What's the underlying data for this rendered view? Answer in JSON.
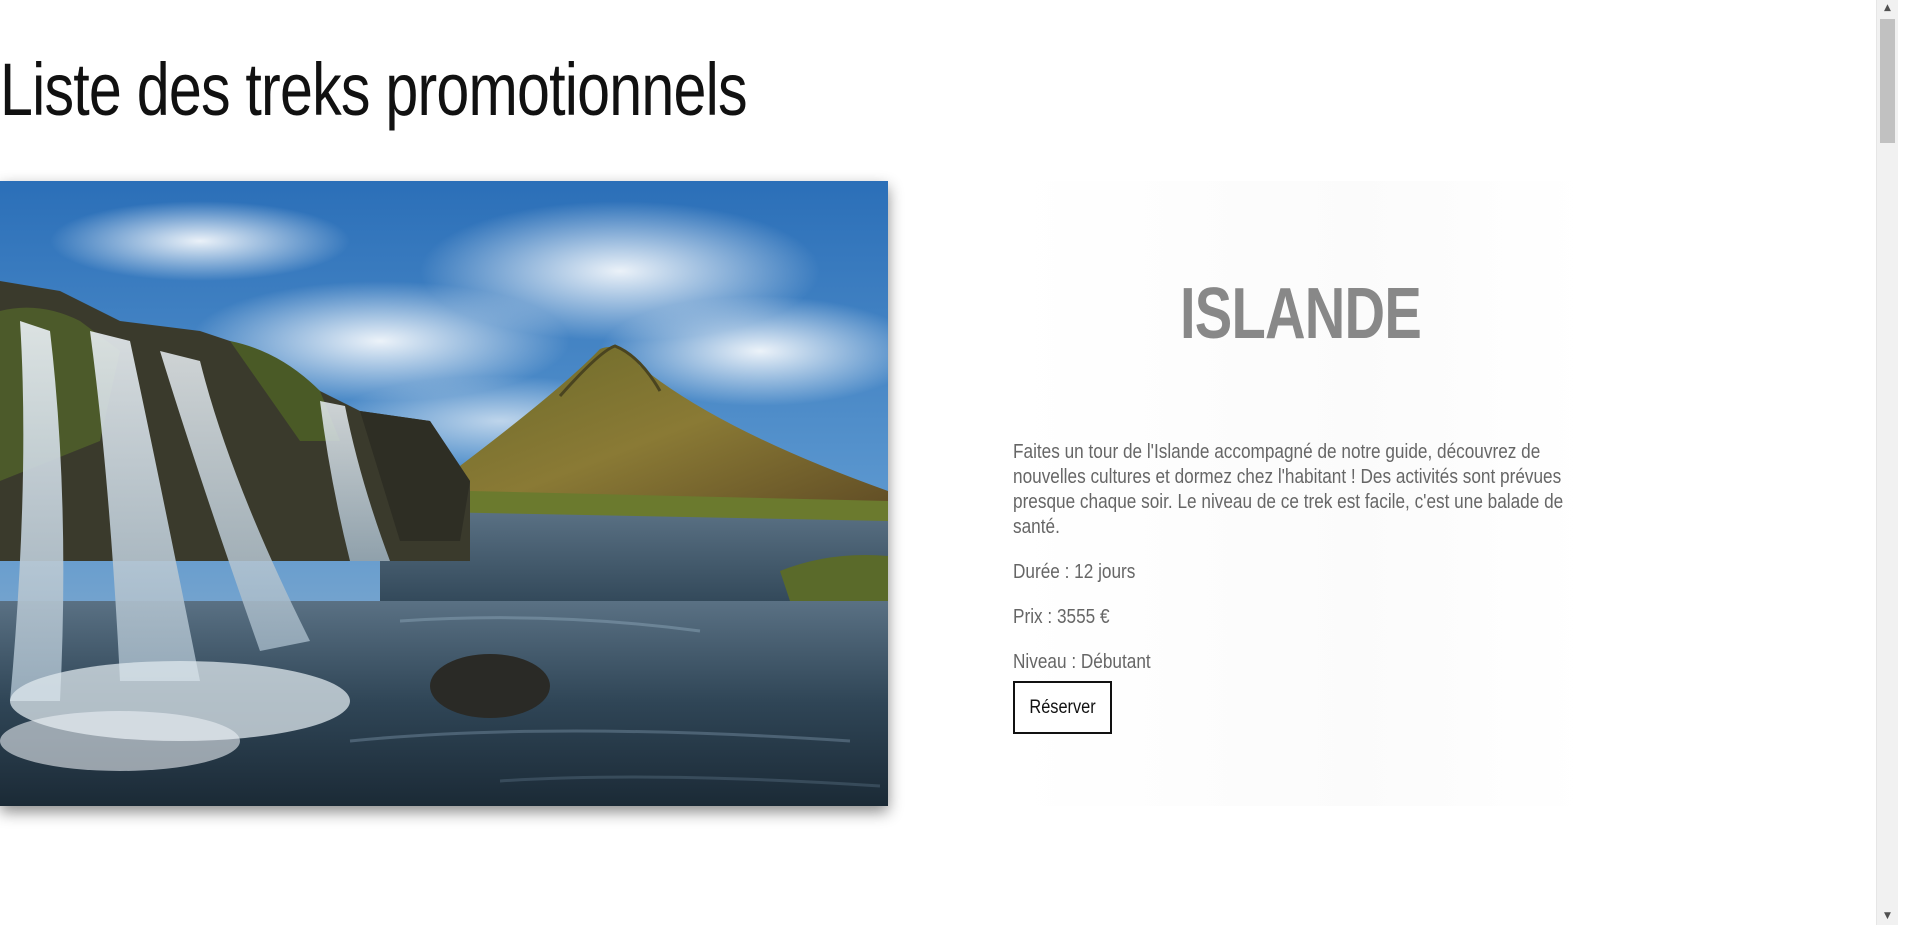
{
  "page": {
    "title": "Liste des treks promotionnels"
  },
  "trek": {
    "image_alt": "waterfall-mountain-photo",
    "name": "ISLANDE",
    "description": "Faites un tour de l'Islande accompagné de notre guide, découvrez de nouvelles cultures et dormez chez l'habitant ! Des activités sont prévues presque chaque soir. Le niveau de ce trek est facile, c'est une balade de santé.",
    "duration": "Durée : 12 jours",
    "price": "Prix : 3555 €",
    "level": "Niveau : Débutant",
    "reserve_label": "Réserver"
  },
  "colors": {
    "title_accent": "#b5d98a",
    "trek_name": "#888888",
    "body_text": "#666666"
  },
  "scrollbar": {
    "up_icon": "chevron-up-icon",
    "down_icon": "chevron-down-icon"
  }
}
